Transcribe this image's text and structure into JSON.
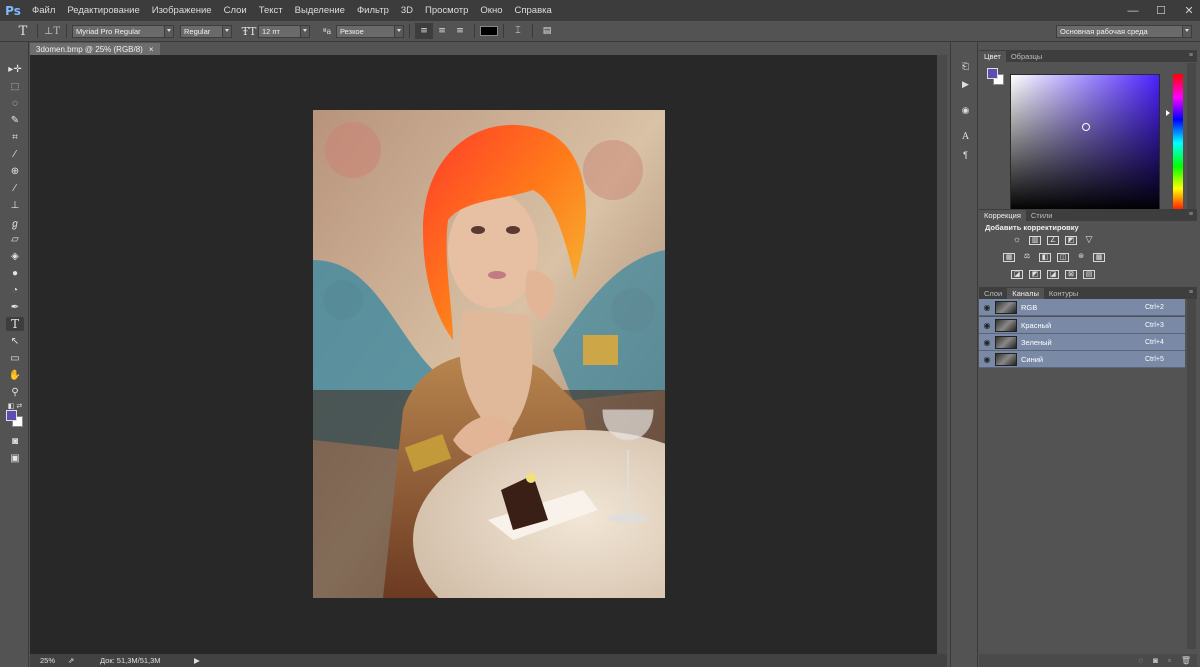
{
  "app": {
    "logo": "Ps"
  },
  "menu": [
    "Файл",
    "Редактирование",
    "Изображение",
    "Слои",
    "Текст",
    "Выделение",
    "Фильтр",
    "3D",
    "Просмотр",
    "Окно",
    "Справка"
  ],
  "window_buttons": {
    "minimize": "—",
    "maximize": "☐",
    "close": "✕"
  },
  "options": {
    "font_family": "Myriad Pro Regular",
    "font_style": "Regular",
    "font_size": "12 пт",
    "aa_label": "ªa",
    "antialias": "Резкое",
    "text_color": "#000000",
    "workspace": "Основная рабочая среда"
  },
  "document": {
    "tab_title": "3domen.bmp @ 25% (RGB/8)",
    "close": "×",
    "zoom": "25%",
    "doc_info": "Док: 51,3M/51,3M"
  },
  "tools": [
    "move-tool",
    "marquee-tool",
    "lasso-tool",
    "quick-select-tool",
    "crop-tool",
    "eyedropper-tool",
    "healing-tool",
    "brush-tool",
    "stamp-tool",
    "history-brush-tool",
    "eraser-tool",
    "gradient-tool",
    "blur-tool",
    "dodge-tool",
    "pen-tool",
    "type-tool",
    "path-select-tool",
    "shape-tool",
    "hand-tool",
    "zoom-tool"
  ],
  "foreground_color": "#5a4fb0",
  "background_color": "#ffffff",
  "color_panel": {
    "tabs": [
      "Цвет",
      "Образцы"
    ]
  },
  "adjustments_panel": {
    "tabs": [
      "Коррекция",
      "Стили"
    ],
    "title": "Добавить корректировку"
  },
  "channels_panel": {
    "tabs": [
      "Слои",
      "Каналы",
      "Контуры"
    ],
    "channels": [
      {
        "name": "RGB",
        "shortcut": "Ctrl+2"
      },
      {
        "name": "Красный",
        "shortcut": "Ctrl+3"
      },
      {
        "name": "Зеленый",
        "shortcut": "Ctrl+4"
      },
      {
        "name": "Синий",
        "shortcut": "Ctrl+5"
      }
    ]
  }
}
